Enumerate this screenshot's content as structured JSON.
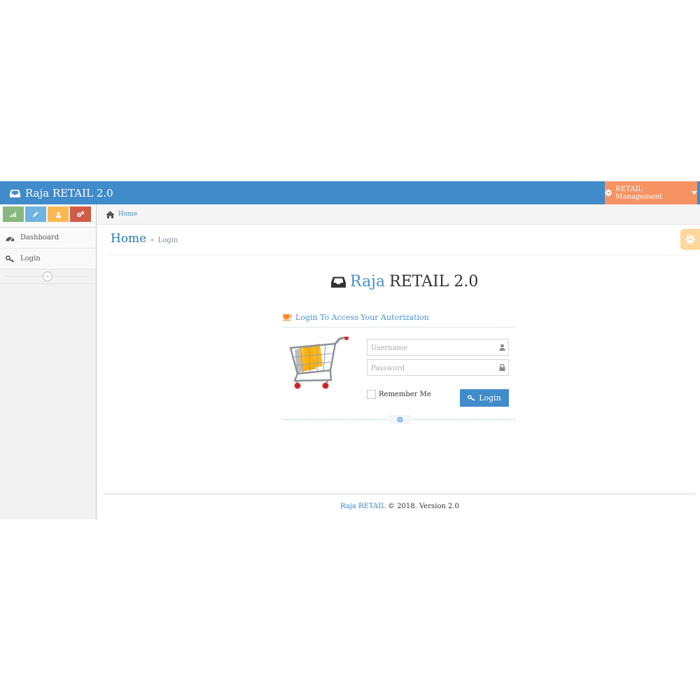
{
  "navbar": {
    "brand": "Raja RETAIL 2.0",
    "brand_icon": "inbox-icon",
    "management_label": "RETAIL Management",
    "colors": {
      "navbar": "#428bca",
      "management": "#f79263"
    }
  },
  "sidebar": {
    "shortcuts": [
      {
        "icon": "signal-icon",
        "color": "#87b87f"
      },
      {
        "icon": "pencil-icon",
        "color": "#6fb3e0"
      },
      {
        "icon": "user-icon",
        "color": "#ffb752"
      },
      {
        "icon": "cogs-icon",
        "color": "#d15b47"
      }
    ],
    "items": [
      {
        "label": "Dashboard",
        "icon": "dashboard-icon"
      },
      {
        "label": "Login",
        "icon": "key-icon"
      }
    ],
    "collapse_glyph": "«"
  },
  "breadcrumb": {
    "home": "Home"
  },
  "page_header": {
    "title": "Home",
    "separator": "»",
    "subtitle": "Login"
  },
  "login": {
    "title_highlight": "Raja",
    "title_rest": "RETAIL 2.0",
    "box_header": "Login To Access Your Autorization",
    "username_placeholder": "Username",
    "password_placeholder": "Password",
    "remember_label": "Remember Me",
    "login_button": "Login"
  },
  "footer": {
    "brand": "Raja RETAIL",
    "rest": "© 2018. Version 2.0"
  }
}
